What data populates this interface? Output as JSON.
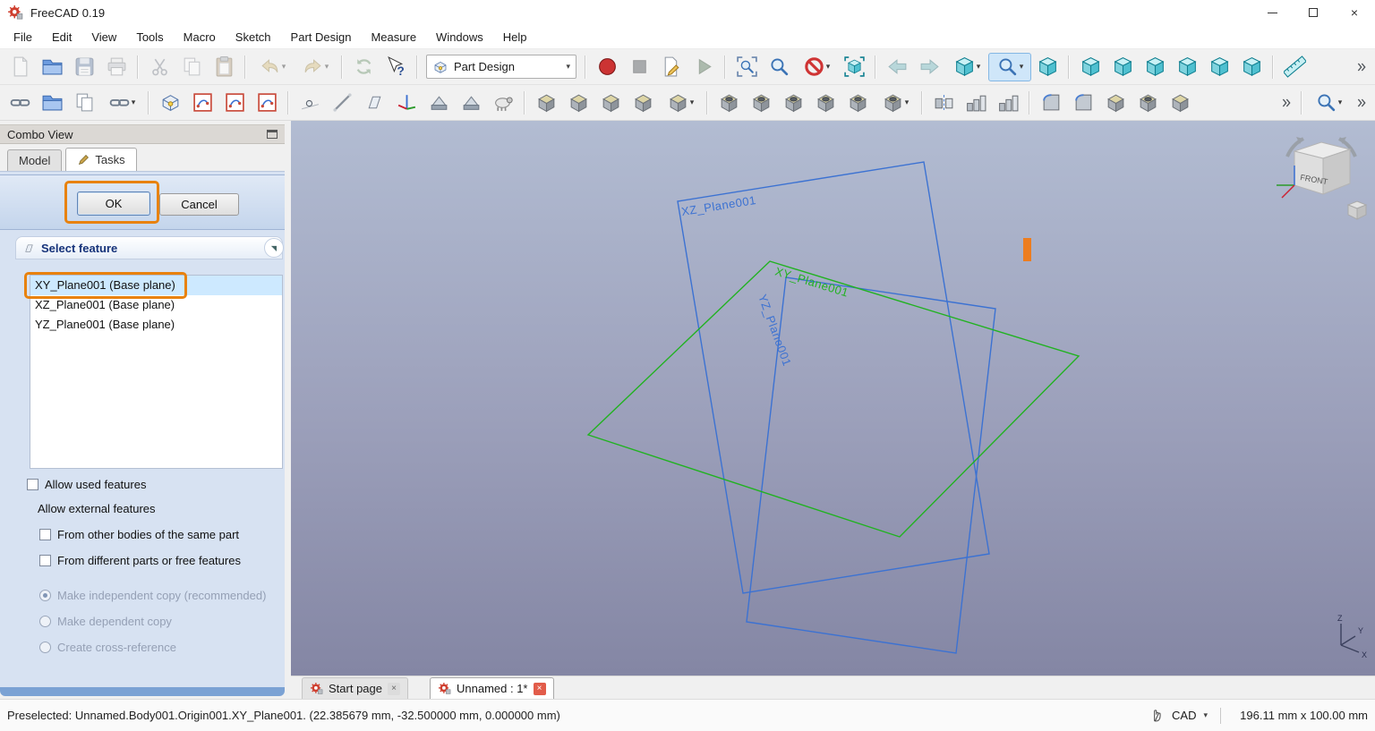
{
  "window": {
    "title": "FreeCAD 0.19"
  },
  "menubar": [
    "File",
    "Edit",
    "View",
    "Tools",
    "Macro",
    "Sketch",
    "Part Design",
    "Measure",
    "Windows",
    "Help"
  ],
  "toolbars": {
    "workbench": {
      "value": "Part Design"
    },
    "row1": [
      {
        "name": "file-new",
        "sym": "page",
        "dim": true
      },
      {
        "name": "file-open",
        "sym": "folder"
      },
      {
        "name": "file-save",
        "sym": "save",
        "dim": true
      },
      {
        "name": "print",
        "sym": "printer",
        "dim": true
      },
      {
        "type": "sep"
      },
      {
        "name": "cut",
        "sym": "scissors",
        "dim": true
      },
      {
        "name": "copy",
        "sym": "copy",
        "dim": true
      },
      {
        "name": "paste",
        "sym": "clipboard",
        "dim": true
      },
      {
        "type": "sep"
      },
      {
        "name": "undo",
        "sym": "undo",
        "dd": true,
        "dim": true
      },
      {
        "name": "redo",
        "sym": "redo",
        "dd": true,
        "dim": true
      },
      {
        "type": "sep"
      },
      {
        "name": "refresh",
        "sym": "refresh",
        "dim": true
      },
      {
        "name": "whats-this",
        "sym": "cursor"
      },
      {
        "type": "sep"
      },
      {
        "type": "combo",
        "name": "workbench-selector"
      },
      {
        "type": "sep"
      },
      {
        "name": "macro-record",
        "sym": "record"
      },
      {
        "name": "macro-stop",
        "sym": "stop",
        "dim": true
      },
      {
        "name": "macro-edit",
        "sym": "macroedit"
      },
      {
        "name": "macro-execute",
        "sym": "play",
        "dim": true
      },
      {
        "type": "sep"
      },
      {
        "name": "zoom-fit-all",
        "sym": "magframe"
      },
      {
        "name": "zoom-box",
        "sym": "mag"
      },
      {
        "name": "clipping-plane",
        "sym": "noentry",
        "dd": true
      },
      {
        "name": "texture-view",
        "sym": "cubeframe"
      },
      {
        "type": "sep"
      },
      {
        "name": "nav-back",
        "sym": "arrowL",
        "dim": true
      },
      {
        "name": "nav-forward",
        "sym": "arrowR",
        "dim": true
      },
      {
        "name": "view-axonometric",
        "sym": "cube",
        "dd": true
      },
      {
        "name": "draw-style",
        "sym": "mag",
        "dd": true,
        "selected": true
      },
      {
        "name": "view-home",
        "sym": "cube"
      },
      {
        "type": "sep"
      },
      {
        "name": "view-front",
        "sym": "cube"
      },
      {
        "name": "view-top",
        "sym": "cube"
      },
      {
        "name": "view-right",
        "sym": "cube"
      },
      {
        "name": "view-rear",
        "sym": "cube"
      },
      {
        "name": "view-bottom",
        "sym": "cube"
      },
      {
        "name": "view-left",
        "sym": "cube"
      },
      {
        "type": "sep"
      },
      {
        "name": "measure-distance",
        "sym": "ruler"
      },
      {
        "type": "spacer"
      },
      {
        "name": "toolbar-overflow-row1",
        "sym": "chevr",
        "overflow": true
      }
    ],
    "row2": [
      {
        "name": "make-link",
        "sym": "chain"
      },
      {
        "name": "make-link-group",
        "sym": "folder"
      },
      {
        "name": "replace-link",
        "sym": "copy"
      },
      {
        "name": "unlink",
        "sym": "chain",
        "dd": true
      },
      {
        "type": "sep"
      },
      {
        "name": "create-body",
        "sym": "body"
      },
      {
        "name": "create-sketch",
        "sym": "sketch"
      },
      {
        "name": "edit-sketch",
        "sym": "sketch"
      },
      {
        "name": "map-sketch-to-face",
        "sym": "sketch"
      },
      {
        "type": "sep"
      },
      {
        "name": "datum-point",
        "sym": "dot"
      },
      {
        "name": "datum-line",
        "sym": "dline"
      },
      {
        "name": "datum-plane",
        "sym": "dplane"
      },
      {
        "name": "local-coordinate-system",
        "sym": "dcs"
      },
      {
        "name": "shape-binder",
        "sym": "binder"
      },
      {
        "name": "sub-shape-binder",
        "sym": "binder"
      },
      {
        "name": "clone",
        "sym": "sheep"
      },
      {
        "type": "sep"
      },
      {
        "name": "pad",
        "sym": "block"
      },
      {
        "name": "revolve",
        "sym": "block"
      },
      {
        "name": "additive-loft",
        "sym": "block"
      },
      {
        "name": "additive-pipe",
        "sym": "block"
      },
      {
        "name": "additive-helix",
        "sym": "block",
        "dd": true
      },
      {
        "type": "sep"
      },
      {
        "name": "pocket",
        "sym": "blockhole"
      },
      {
        "name": "hole",
        "sym": "blockhole"
      },
      {
        "name": "groove",
        "sym": "blockhole"
      },
      {
        "name": "subtractive-loft",
        "sym": "blockhole"
      },
      {
        "name": "subtractive-pipe",
        "sym": "blockhole"
      },
      {
        "name": "subtractive-helix",
        "sym": "blockhole",
        "dd": true
      },
      {
        "type": "sep"
      },
      {
        "name": "mirrored",
        "sym": "mirrorblk"
      },
      {
        "name": "linear-pattern",
        "sym": "pattern"
      },
      {
        "name": "polar-pattern",
        "sym": "pattern"
      },
      {
        "type": "sep"
      },
      {
        "name": "fillet",
        "sym": "fillet"
      },
      {
        "name": "chamfer",
        "sym": "fillet"
      },
      {
        "name": "draft",
        "sym": "block"
      },
      {
        "name": "thickness",
        "sym": "blockhole"
      },
      {
        "name": "boolean-operation",
        "sym": "block"
      },
      {
        "type": "spacer"
      },
      {
        "name": "toolbar-overflow-row2",
        "sym": "chevr",
        "overflow": true
      },
      {
        "type": "sep"
      },
      {
        "name": "selection-view",
        "sym": "mag",
        "dd": true
      },
      {
        "name": "toolbar-overflow-row2b",
        "sym": "chevr",
        "overflow": true
      }
    ]
  },
  "combo_view": {
    "title": "Combo View",
    "tabs": [
      {
        "label": "Model",
        "active": false
      },
      {
        "label": "Tasks",
        "active": true,
        "icon": "pen-icon"
      }
    ],
    "task": {
      "ok": "OK",
      "cancel": "Cancel",
      "section": "Select feature",
      "features": [
        {
          "label": "XY_Plane001 (Base plane)",
          "selected": true,
          "annotated": true
        },
        {
          "label": "XZ_Plane001 (Base plane)",
          "selected": false
        },
        {
          "label": "YZ_Plane001 (Base plane)",
          "selected": false
        }
      ],
      "options": {
        "allow_used": {
          "label": "Allow used features",
          "checked": false
        },
        "external_header": "Allow external features",
        "from_other_bodies": {
          "label": "From other bodies of the same part",
          "checked": false
        },
        "from_different_parts": {
          "label": "From different parts or free features",
          "checked": false
        },
        "copy_modes": [
          {
            "name": "make-independent-copy",
            "label": "Make independent copy (recommended)",
            "selected": true
          },
          {
            "name": "make-dependent-copy",
            "label": "Make dependent copy",
            "selected": false
          },
          {
            "name": "create-cross-reference",
            "label": "Create cross-reference",
            "selected": false
          }
        ]
      }
    }
  },
  "viewport": {
    "planes": [
      {
        "label": "XZ_Plane001",
        "color": "#3c72d2"
      },
      {
        "label": "XY_Plane001",
        "color": "#21b221"
      },
      {
        "label": "YZ_Plane001",
        "color": "#3c72d2"
      }
    ],
    "navigation_cube": {
      "front_label": "FRONT"
    },
    "axis_labels": [
      "Z",
      "Y",
      "X"
    ]
  },
  "document_tabs": [
    {
      "label": "Start page",
      "active": false
    },
    {
      "label": "Unnamed : 1*",
      "active": true
    }
  ],
  "statusbar": {
    "message": "Preselected: Unnamed.Body001.Origin001.XY_Plane001. (22.385679 mm, -32.500000 mm, 0.000000 mm)",
    "nav_style": "CAD",
    "dimension_readout": "196.11 mm x 100.00 mm"
  },
  "colors": {
    "annotation": "#e8820e",
    "selection_bg": "#cde9ff",
    "plane_blue": "#3c72d2",
    "plane_green": "#21b221",
    "viewport_gradient_top": "#b2bcd2",
    "viewport_gradient_bottom": "#8486a4"
  }
}
